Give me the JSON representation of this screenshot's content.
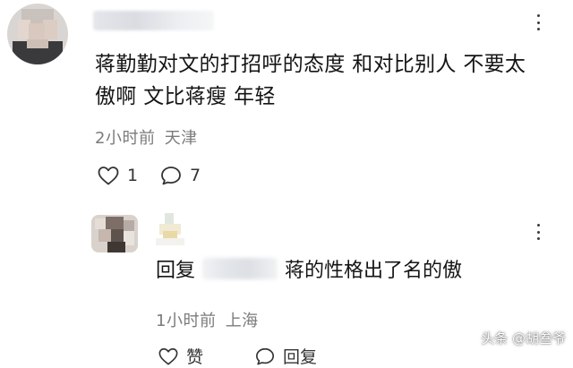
{
  "comment": {
    "text": "蒋勤勤对文的打招呼的态度 和对比别人 不要太傲啊 文比蒋瘦 年轻",
    "time": "2小时前",
    "location": "天津",
    "like_count": "1",
    "reply_count": "7",
    "avatar_icon": "blurred-user-avatar",
    "more_icon": "more-vertical-icon"
  },
  "reply": {
    "prefix": "回复",
    "text": "蒋的性格出了名的傲",
    "time": "1小时前",
    "location": "上海",
    "like_label": "赞",
    "reply_label": "回复",
    "avatar_icon": "blurred-user-avatar",
    "more_icon": "more-vertical-icon"
  },
  "watermark": "头条 @胡叁爷",
  "colors": {
    "text": "#151515",
    "meta": "#7b7b7b",
    "background": "#ffffff"
  }
}
